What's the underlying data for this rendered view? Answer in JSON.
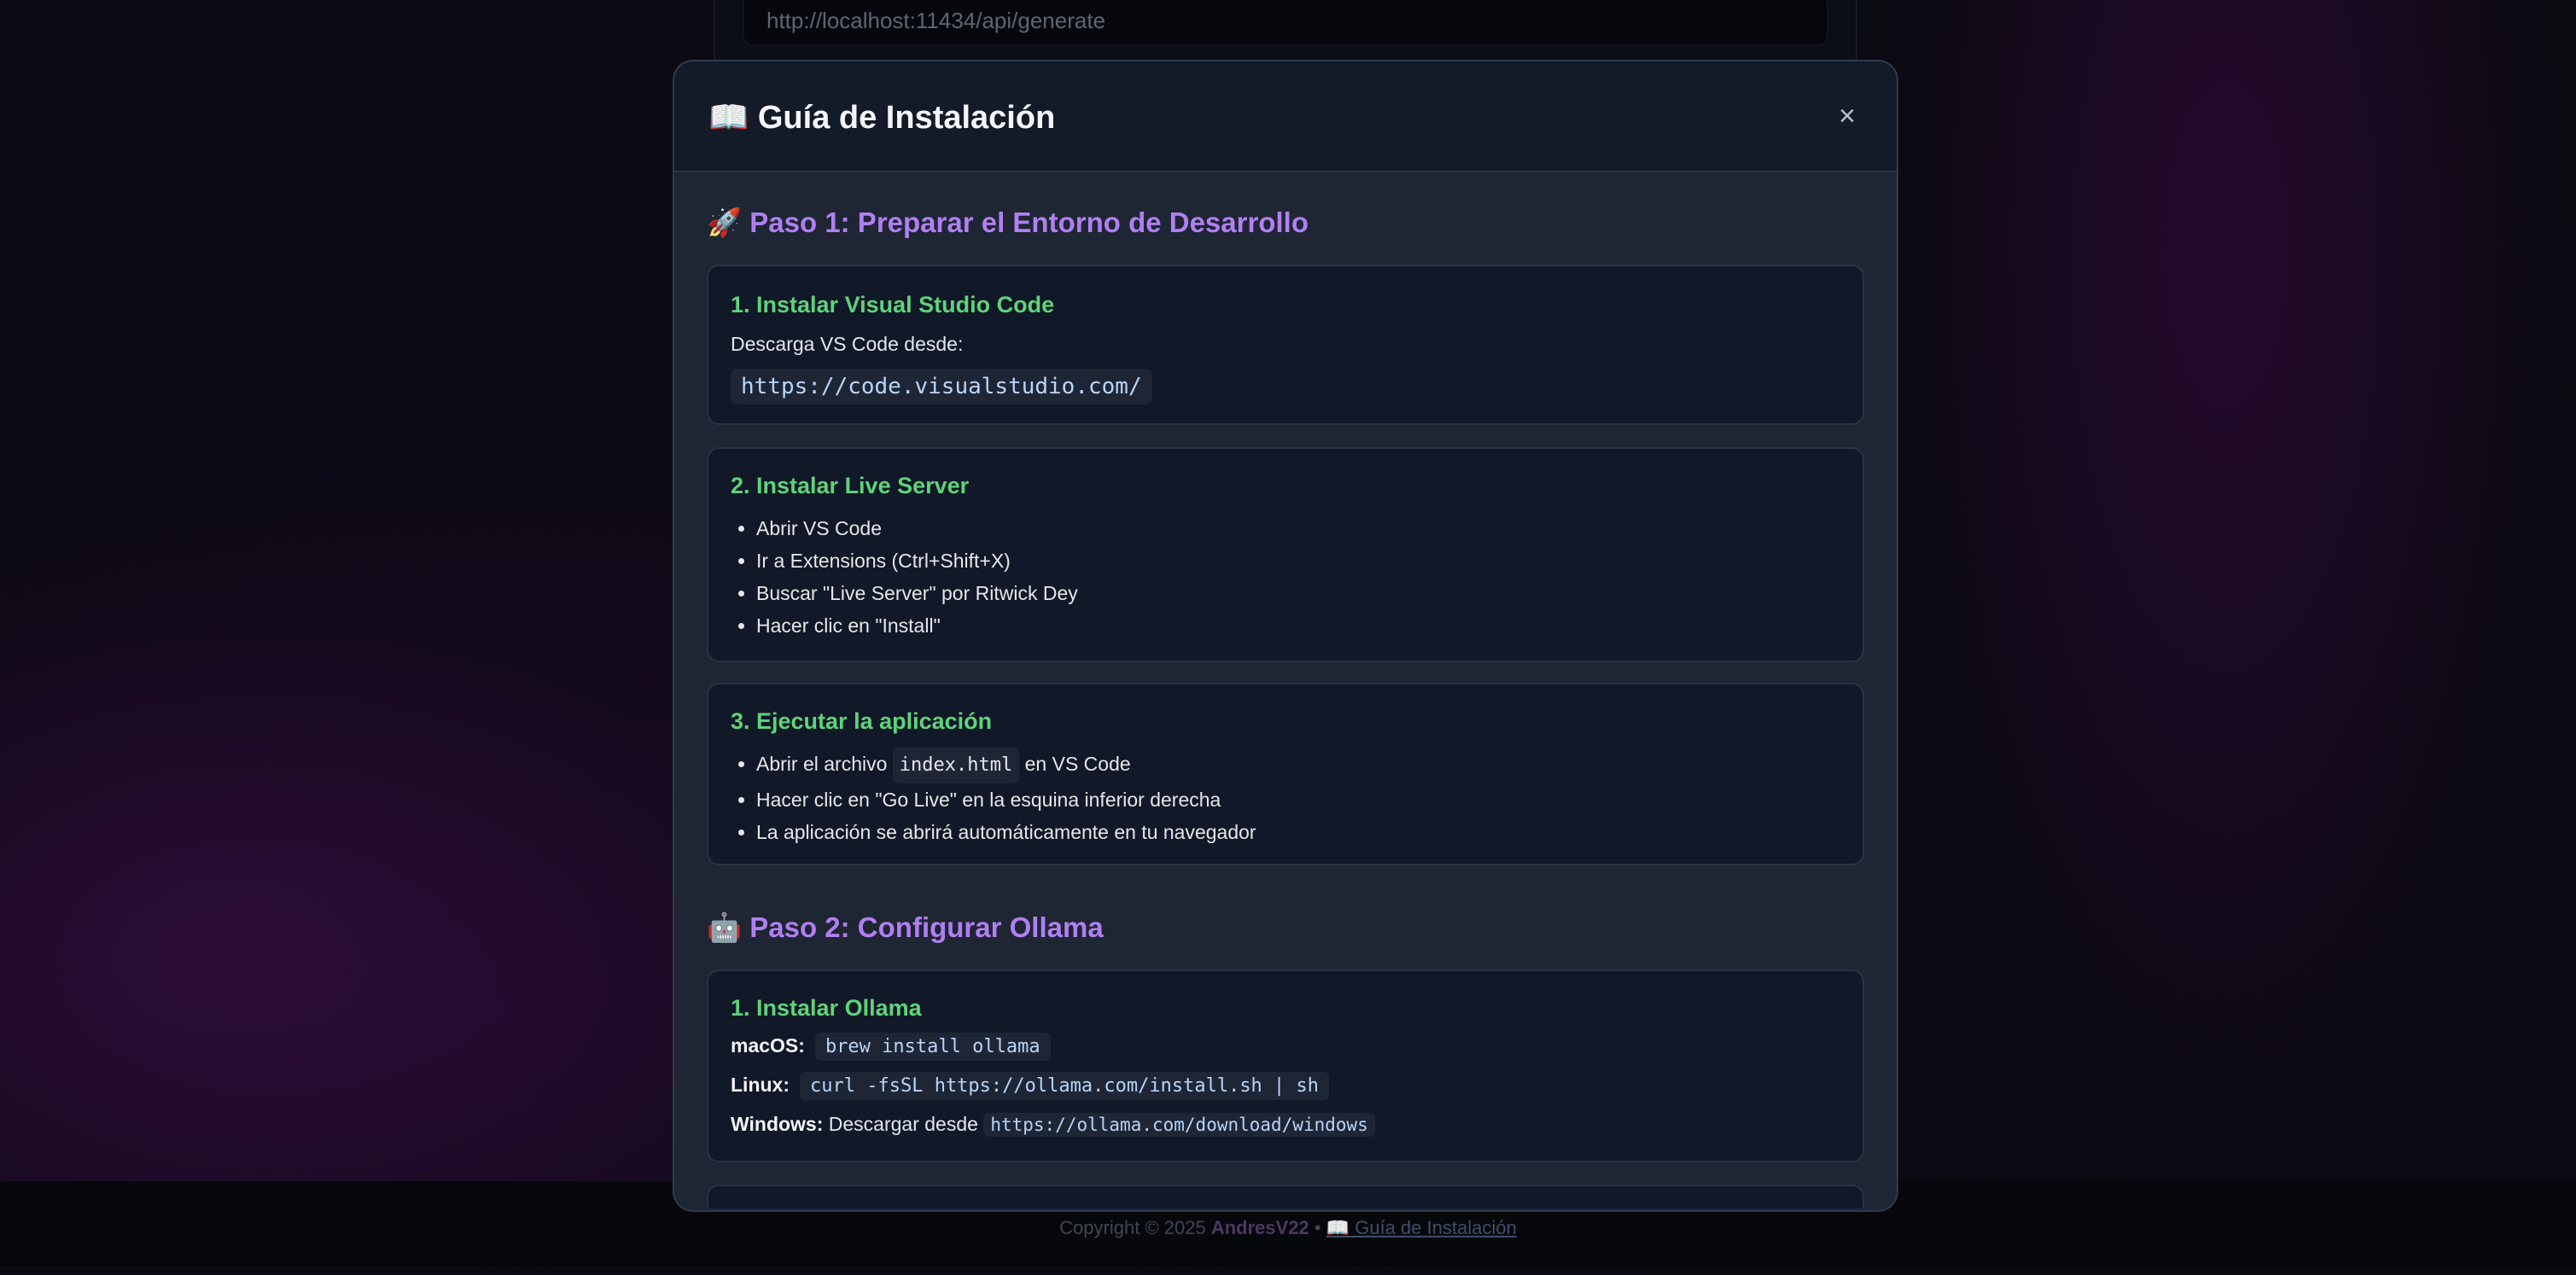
{
  "background": {
    "url_input_value": "http://localhost:11434/api/generate"
  },
  "footer": {
    "copyright": "Copyright © 2025 ",
    "author": "AndresV22",
    "separator": " • ",
    "guide_link": "📖 Guía de Instalación"
  },
  "modal": {
    "title": "📖 Guía de Instalación",
    "close_label": "×",
    "step1": {
      "title": "🚀 Paso 1: Preparar el Entorno de Desarrollo",
      "card1": {
        "heading": "1. Instalar Visual Studio Code",
        "text": "Descarga VS Code desde:",
        "code": "https://code.visualstudio.com/"
      },
      "card2": {
        "heading": "2. Instalar Live Server",
        "items": [
          "Abrir VS Code",
          "Ir a Extensions (Ctrl+Shift+X)",
          "Buscar \"Live Server\" por Ritwick Dey",
          "Hacer clic en \"Install\""
        ]
      },
      "card3": {
        "heading": "3. Ejecutar la aplicación",
        "item1_before": "Abrir el archivo ",
        "item1_code": "index.html",
        "item1_after": " en VS Code",
        "item2": "Hacer clic en \"Go Live\" en la esquina inferior derecha",
        "item3": "La aplicación se abrirá automáticamente en tu navegador"
      }
    },
    "step2": {
      "title": "🤖 Paso 2: Configurar Ollama",
      "card1": {
        "heading": "1. Instalar Ollama",
        "macos_label": "macOS:",
        "macos_cmd": "brew install ollama",
        "linux_label": "Linux:",
        "linux_cmd": "curl -fsSL https://ollama.com/install.sh | sh",
        "windows_label": "Windows:",
        "windows_text": " Descargar desde ",
        "windows_url": "https://ollama.com/download/windows"
      }
    }
  }
}
